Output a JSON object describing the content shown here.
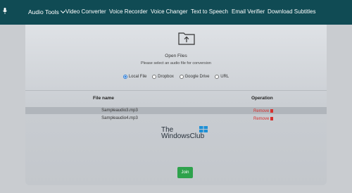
{
  "nav": {
    "items": [
      {
        "label": "Audio Tools",
        "active": true
      },
      {
        "label": "Video Converter"
      },
      {
        "label": "Voice Recorder"
      },
      {
        "label": "Voice Changer"
      },
      {
        "label": "Text to Speech"
      },
      {
        "label": "Email Verifier"
      },
      {
        "label": "Download Subtitles"
      }
    ]
  },
  "open": {
    "title": "Open Files",
    "subtitle": "Please select an audio file for conversion"
  },
  "sources": [
    {
      "label": "Local File",
      "selected": true
    },
    {
      "label": "Dropbox",
      "selected": false
    },
    {
      "label": "Google Drive",
      "selected": false
    },
    {
      "label": "URL",
      "selected": false
    }
  ],
  "table": {
    "headers": {
      "file": "File name",
      "operation": "Operation"
    },
    "rows": [
      {
        "file": "Sampleaudio3.mp3",
        "action": "Remove"
      },
      {
        "file": "Sampleaudio4.mp3",
        "action": "Remove"
      }
    ]
  },
  "watermark": {
    "line1": "The",
    "line2": "WindowsClub"
  },
  "join_label": "Join",
  "colors": {
    "topbar": "#104b54",
    "join": "#2ea24c",
    "remove": "#d6312e",
    "selected_radio": "#2a7bd6"
  }
}
